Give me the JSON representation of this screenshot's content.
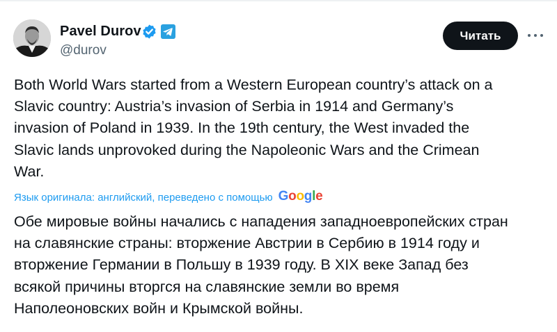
{
  "author": {
    "name": "Pavel Durov",
    "handle": "@durov",
    "avatar_icon": "avatar-photo",
    "badges": [
      "verified-icon",
      "telegram-icon"
    ]
  },
  "actions": {
    "read_label": "Читать",
    "more_icon": "more-icon"
  },
  "tweet": {
    "original_lines": [
      "Both World Wars started from a Western European country’s attack on a",
      "Slavic country: Austria’s invasion of Serbia in 1914 and Germany’s",
      "invasion of Poland in 1939. In the 19th century, the West invaded the",
      "Slavic lands unprovoked during the Napoleonic Wars and the Crimean",
      "War."
    ],
    "translation_note": "Язык оригинала: английский, переведено с помощью",
    "translation_provider": [
      "G",
      "o",
      "o",
      "g",
      "l",
      "e"
    ],
    "translated_lines": [
      "Обе мировые войны начались с нападения западноевропейских стран",
      "на славянские страны: вторжение Австрии в Сербию в 1914 году и",
      "вторжение Германии в Польшу в 1939 году. В XIX веке Запад без",
      "всякой причины вторгся на славянские земли во время",
      "Наполеоновских войн и Крымской войны."
    ]
  },
  "colors": {
    "link": "#1d9bf0",
    "text": "#0f1419",
    "secondary": "#536471",
    "button_bg": "#0f1419"
  }
}
